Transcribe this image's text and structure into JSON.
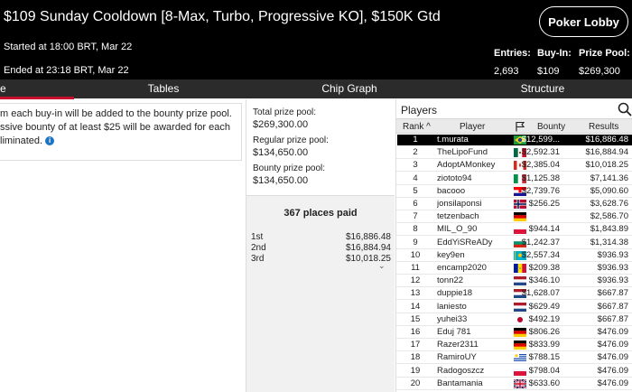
{
  "header": {
    "title": "$109 Sunday Cooldown [8-Max, Turbo, Progressive KO], $150K Gtd",
    "started": "Started at 18:00 BRT, Mar 22",
    "ended": "Ended at 23:18 BRT, Mar 22",
    "lobby_button": "Poker Lobby",
    "entries_label": "Entries:",
    "entries_value": "2,693",
    "buyin_label": "Buy-In:",
    "buyin_value": "$109",
    "prizepool_label": "Prize Pool:",
    "prizepool_value": "$269,300"
  },
  "tabs": [
    {
      "label": "e"
    },
    {
      "label": "Tables"
    },
    {
      "label": "Chip Graph"
    },
    {
      "label": "Structure"
    }
  ],
  "info": {
    "line1": "m each buy-in will be added to the bounty prize pool.",
    "line2": "ssive bounty of at least $25 will be awarded for each",
    "line3": "liminated."
  },
  "pools": {
    "total_label": "Total prize pool:",
    "total_value": "$269,300.00",
    "regular_label": "Regular prize pool:",
    "regular_value": "$134,650.00",
    "bounty_label": "Bounty prize pool:",
    "bounty_value": "$134,650.00"
  },
  "places": {
    "title": "367 places paid",
    "payouts": [
      {
        "pos": "1st",
        "amount": "$16,886.48"
      },
      {
        "pos": "2nd",
        "amount": "$16,884.94"
      },
      {
        "pos": "3rd",
        "amount": "$10,018.25"
      }
    ]
  },
  "players": {
    "title": "Players",
    "columns": {
      "rank": "Rank",
      "player": "Player",
      "bounty": "Bounty",
      "results": "Results"
    },
    "rows": [
      {
        "rank": "1",
        "name": "t.murata",
        "flag": "br",
        "bounty": "$12,599...",
        "result": "$16,886.48"
      },
      {
        "rank": "2",
        "name": "TheLipoFund",
        "flag": "mx",
        "bounty": "$2,592.31",
        "result": "$16,884.94"
      },
      {
        "rank": "3",
        "name": "AdoptAMonkey",
        "flag": "ca",
        "bounty": "$2,385.04",
        "result": "$10,018.25"
      },
      {
        "rank": "4",
        "name": "ziototo94",
        "flag": "it",
        "bounty": "$1,125.38",
        "result": "$7,141.36"
      },
      {
        "rank": "5",
        "name": "bacooo",
        "flag": "hr",
        "bounty": "$2,739.76",
        "result": "$5,090.60"
      },
      {
        "rank": "6",
        "name": "jonsilaponsi",
        "flag": "no",
        "bounty": "$256.25",
        "result": "$3,628.76"
      },
      {
        "rank": "7",
        "name": "tetzenbach",
        "flag": "de",
        "bounty": "",
        "result": "$2,586.70"
      },
      {
        "rank": "8",
        "name": "MIL_O_90",
        "flag": "pl",
        "bounty": "$944.14",
        "result": "$1,843.89"
      },
      {
        "rank": "9",
        "name": "EddYiSReADy",
        "flag": "bg",
        "bounty": "$1,242.37",
        "result": "$1,314.38"
      },
      {
        "rank": "10",
        "name": "key9en",
        "flag": "kz",
        "bounty": "$2,557.34",
        "result": "$936.93"
      },
      {
        "rank": "11",
        "name": "encamp2020",
        "flag": "ad",
        "bounty": "$209.38",
        "result": "$936.93"
      },
      {
        "rank": "12",
        "name": "tonn22",
        "flag": "nl",
        "bounty": "$346.10",
        "result": "$936.93"
      },
      {
        "rank": "13",
        "name": "duppie18",
        "flag": "nl",
        "bounty": "$1,628.07",
        "result": "$667.87"
      },
      {
        "rank": "14",
        "name": "laniesto",
        "flag": "nl",
        "bounty": "$629.49",
        "result": "$667.87"
      },
      {
        "rank": "15",
        "name": "yuhei33",
        "flag": "jp",
        "bounty": "$492.19",
        "result": "$667.87"
      },
      {
        "rank": "16",
        "name": "Eduj 781",
        "flag": "de",
        "bounty": "$806.26",
        "result": "$476.09"
      },
      {
        "rank": "17",
        "name": "Razer2311",
        "flag": "de",
        "bounty": "$833.99",
        "result": "$476.09"
      },
      {
        "rank": "18",
        "name": "RamiroUY",
        "flag": "uy",
        "bounty": "$788.15",
        "result": "$476.09"
      },
      {
        "rank": "19",
        "name": "Radogoszcz",
        "flag": "pl",
        "bounty": "$798.04",
        "result": "$476.09"
      },
      {
        "rank": "20",
        "name": "Bantamania",
        "flag": "gb",
        "bounty": "$633.60",
        "result": "$476.09"
      }
    ]
  }
}
